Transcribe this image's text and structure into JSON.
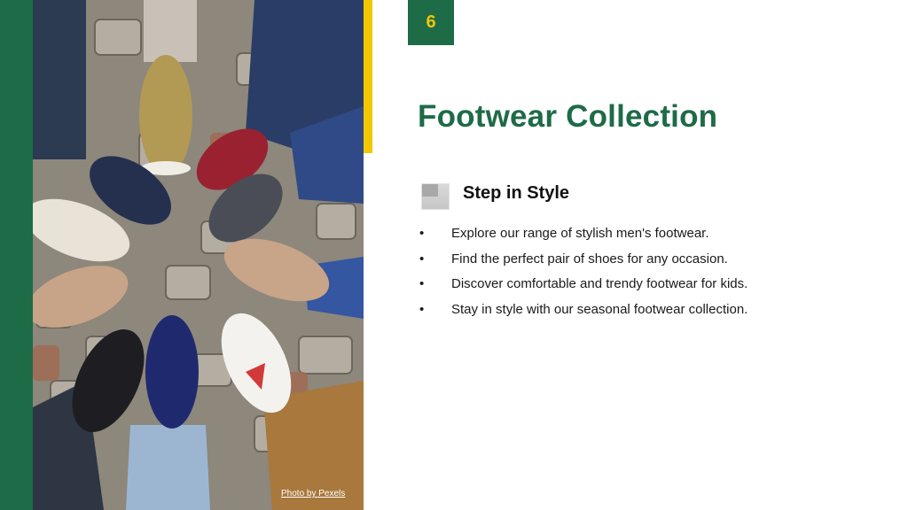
{
  "slide": {
    "page_number": "6",
    "title": "Footwear Collection",
    "subheading": "Step in Style",
    "bullets": [
      "Explore our range of stylish men's footwear.",
      "Find the perfect pair of shoes for any occasion.",
      "Discover comfortable and trendy footwear for kids.",
      "Stay in style with our seasonal footwear collection."
    ],
    "bullet_symbol": "•",
    "photo_credit": "Photo by Pexels"
  },
  "colors": {
    "brand_green": "#1e6b47",
    "accent_yellow": "#f2c600",
    "background": "#ffffff"
  },
  "icons": {
    "subheading_icon": "placeholder-image-icon"
  }
}
